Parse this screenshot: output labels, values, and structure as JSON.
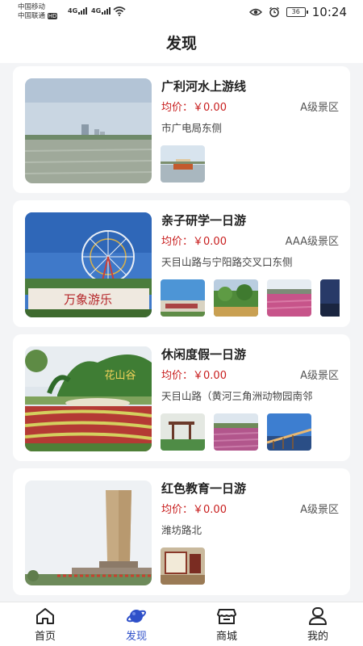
{
  "status_bar": {
    "carrier1": "中国移动",
    "carrier2": "中国联通",
    "hd_badge": "HD",
    "net1": "4G",
    "net2": "4G",
    "battery": "36",
    "time": "10:24"
  },
  "header": {
    "title": "发现"
  },
  "cards": [
    {
      "title": "广利河水上游线",
      "price_label": "均价：",
      "price": "￥0.00",
      "level": "A级景区",
      "address": "市广电局东侧",
      "thumbs": 1
    },
    {
      "title": "亲子研学一日游",
      "price_label": "均价：",
      "price": "￥0.00",
      "level": "AAA级景区",
      "address": "天目山路与宁阳路交叉口东侧",
      "image_text": "万象游乐",
      "thumbs": 4
    },
    {
      "title": "休闲度假一日游",
      "price_label": "均价：",
      "price": "￥0.00",
      "level": "A级景区",
      "address": "天目山路（黄河三角洲动物园南邻",
      "image_text": "花山谷",
      "thumbs": 3
    },
    {
      "title": "红色教育一日游",
      "price_label": "均价：",
      "price": "￥0.00",
      "level": "A级景区",
      "address": "潍坊路北",
      "thumbs": 1
    }
  ],
  "tabbar": {
    "active_color": "#2f50c9",
    "items": [
      {
        "label": "首页",
        "icon": "home-icon"
      },
      {
        "label": "发现",
        "icon": "planet-icon"
      },
      {
        "label": "商城",
        "icon": "shop-icon"
      },
      {
        "label": "我的",
        "icon": "user-icon"
      }
    ]
  }
}
